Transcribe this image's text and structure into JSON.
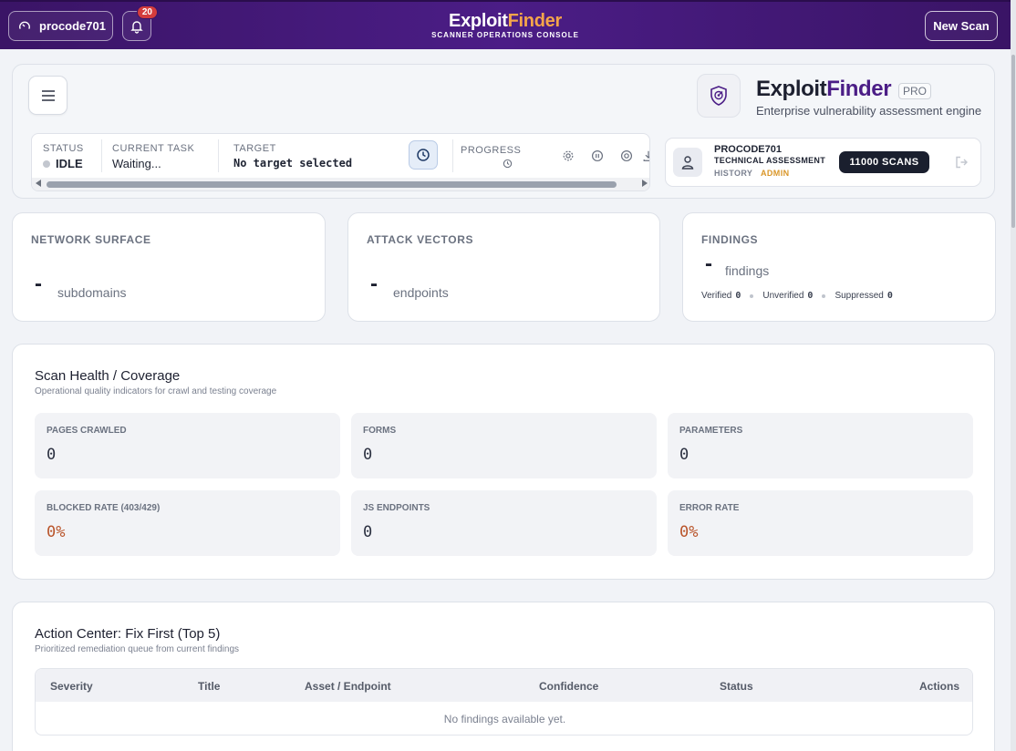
{
  "topbar": {
    "username": "procode701",
    "notification_count": "20",
    "brand_main": "Exploit",
    "brand_accent": "Finder",
    "brand_subtitle": "SCANNER OPERATIONS CONSOLE",
    "new_scan_label": "New Scan",
    "brand_accent_color": "#f5a54a"
  },
  "hero": {
    "title_main": "Exploit",
    "title_accent": "Finder",
    "badge": "PRO",
    "subtitle": "Enterprise vulnerability assessment engine",
    "status_label": "STATUS",
    "status_value": "IDLE",
    "task_label": "CURRENT TASK",
    "task_value": "Waiting...",
    "target_label": "TARGET",
    "target_value": "No target selected",
    "progress_label": "PROGRESS"
  },
  "user_card": {
    "name": "PROCODE701",
    "role": "TECHNICAL ASSESSMENT",
    "history": "HISTORY",
    "admin": "ADMIN",
    "scans": "11000 SCANS"
  },
  "stats": {
    "network": {
      "title": "NETWORK SURFACE",
      "value": "-",
      "unit": "subdomains"
    },
    "attack": {
      "title": "ATTACK VECTORS",
      "value": "-",
      "unit": "endpoints"
    },
    "findings": {
      "title": "FINDINGS",
      "value": "-",
      "unit": "findings",
      "verified_label": "Verified",
      "verified": "0",
      "unverified_label": "Unverified",
      "unverified": "0",
      "suppressed_label": "Suppressed",
      "suppressed": "0"
    }
  },
  "scan_health": {
    "title": "Scan Health / Coverage",
    "subtitle": "Operational quality indicators for crawl and testing coverage",
    "metrics": [
      {
        "label": "PAGES CRAWLED",
        "value": "0"
      },
      {
        "label": "FORMS",
        "value": "0"
      },
      {
        "label": "PARAMETERS",
        "value": "0"
      },
      {
        "label": "BLOCKED RATE (403/429)",
        "value": "0%"
      },
      {
        "label": "JS ENDPOINTS",
        "value": "0"
      },
      {
        "label": "ERROR RATE",
        "value": "0%"
      }
    ]
  },
  "action_center": {
    "title": "Action Center: Fix First (Top 5)",
    "subtitle": "Prioritized remediation queue from current findings",
    "columns": [
      "Severity",
      "Title",
      "Asset / Endpoint",
      "Confidence",
      "Status",
      "Actions"
    ],
    "empty_message": "No findings available yet."
  }
}
